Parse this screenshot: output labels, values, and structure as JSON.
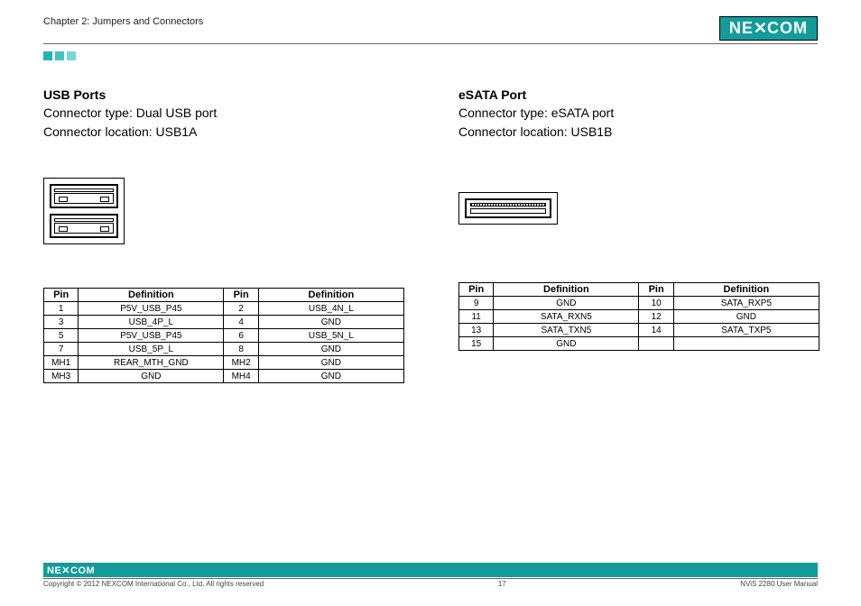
{
  "header": {
    "chapter": "Chapter 2: Jumpers and Connectors",
    "logo": "NE COM",
    "logo_mid": "✕"
  },
  "left": {
    "title": "USB Ports",
    "type_line": "Connector type: Dual USB port",
    "loc_line": "Connector location: USB1A",
    "table": {
      "headers": [
        "Pin",
        "Definition",
        "Pin",
        "Definition"
      ],
      "rows": [
        [
          "1",
          "P5V_USB_P45",
          "2",
          "USB_4N_L"
        ],
        [
          "3",
          "USB_4P_L",
          "4",
          "GND"
        ],
        [
          "5",
          "P5V_USB_P45",
          "6",
          "USB_5N_L"
        ],
        [
          "7",
          "USB_5P_L",
          "8",
          "GND"
        ],
        [
          "MH1",
          "REAR_MTH_GND",
          "MH2",
          "GND"
        ],
        [
          "MH3",
          "GND",
          "MH4",
          "GND"
        ]
      ]
    }
  },
  "right": {
    "title": "eSATA Port",
    "type_line": "Connector type: eSATA port",
    "loc_line": "Connector location: USB1B",
    "table": {
      "headers": [
        "Pin",
        "Definition",
        "Pin",
        "Definition"
      ],
      "rows": [
        [
          "9",
          "GND",
          "10",
          "SATA_RXP5"
        ],
        [
          "11",
          "SATA_RXN5",
          "12",
          "GND"
        ],
        [
          "13",
          "SATA_TXN5",
          "14",
          "SATA_TXP5"
        ],
        [
          "15",
          "GND",
          "",
          ""
        ]
      ]
    }
  },
  "footer": {
    "logo": "NEXCOM",
    "copyright": "Copyright © 2012 NEXCOM International Co., Ltd. All rights reserved",
    "page": "17",
    "manual": "NViS 2280 User Manual"
  }
}
